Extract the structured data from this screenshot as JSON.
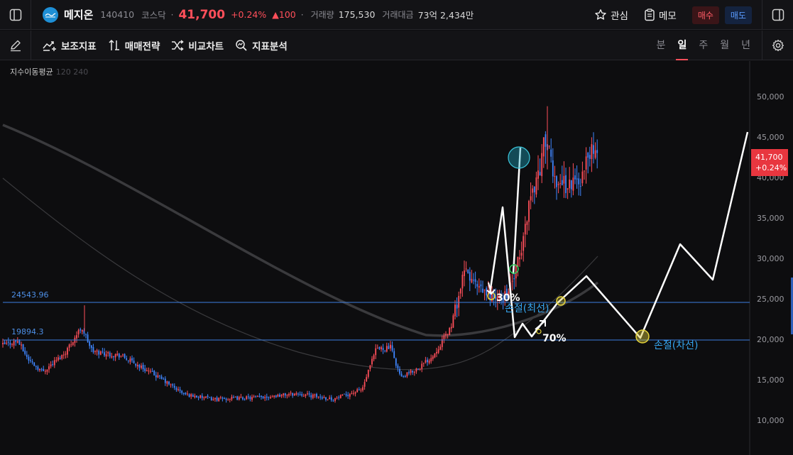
{
  "header": {
    "stock_name": "메지온",
    "code": "140410",
    "market": "코스닥",
    "sep": "·",
    "price": "41,700",
    "change_pct": "+0.24%",
    "change_abs": "▲100",
    "volume_label": "거래량",
    "volume": "175,530",
    "amount_label": "거래대금",
    "amount": "73억 2,434만",
    "watch_label": "관심",
    "memo_label": "메모",
    "buy_label": "매수",
    "sell_label": "매도",
    "logo_icon": "mezion-logo-icon",
    "up_color": "#ff4f5a",
    "down_color": "#3f86ff"
  },
  "toolbar": {
    "indicators": "보조지표",
    "strategy": "매매전략",
    "compare": "비교차트",
    "analysis": "지표분석",
    "periods": [
      "분",
      "일",
      "주",
      "월",
      "년"
    ],
    "active_period": "일"
  },
  "chart": {
    "ma_label": "지수이동평균",
    "ma_periods": "120 240",
    "current_price_tag": "41,700",
    "current_change_tag": "+0.24%",
    "y_ticks": [
      "50,000",
      "45,000",
      "40,000",
      "35,000",
      "30,000",
      "25,000",
      "20,000",
      "15,000",
      "10,000"
    ],
    "hline_upper": "24543.96",
    "hline_lower": "19894.3",
    "annotation_30": "30%",
    "annotation_70": "70%",
    "stop_recent": "손절(최선)",
    "stop_next": "손절(차선)"
  },
  "chart_data": {
    "type": "candlestick",
    "y_range": [
      8000,
      54000
    ],
    "y_ticks": [
      50000,
      45000,
      40000,
      35000,
      30000,
      25000,
      20000,
      15000,
      10000
    ],
    "horizontal_lines": [
      24543.96,
      19894.3
    ],
    "last_close": 41700,
    "last_change_pct": 0.24,
    "moving_averages": [
      "EMA 120",
      "EMA 240"
    ]
  }
}
